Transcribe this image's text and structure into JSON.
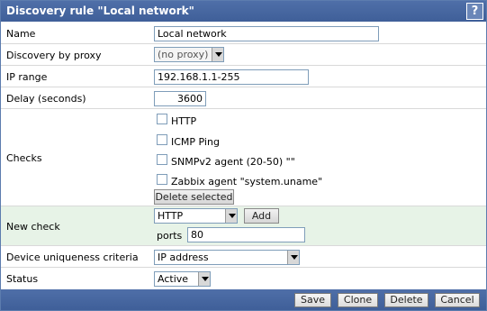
{
  "title": "Discovery rule \"Local network\"",
  "help_label": "?",
  "fields": {
    "name": {
      "label": "Name",
      "value": "Local network"
    },
    "proxy": {
      "label": "Discovery by proxy",
      "value": "(no proxy)"
    },
    "ip_range": {
      "label": "IP range",
      "value": "192.168.1.1-255"
    },
    "delay": {
      "label": "Delay (seconds)",
      "value": "3600"
    },
    "checks": {
      "label": "Checks",
      "items": [
        {
          "label": "HTTP",
          "checked": false
        },
        {
          "label": "ICMP Ping",
          "checked": false
        },
        {
          "label": "SNMPv2 agent (20-50) \"\"",
          "checked": false
        },
        {
          "label": "Zabbix agent \"system.uname\"",
          "checked": false
        }
      ],
      "delete_label": "Delete selected"
    },
    "new_check": {
      "label": "New check",
      "type_value": "HTTP",
      "add_label": "Add",
      "ports_label": "ports",
      "ports_value": "80"
    },
    "uniqueness": {
      "label": "Device uniqueness criteria",
      "value": "IP address"
    },
    "status": {
      "label": "Status",
      "value": "Active"
    }
  },
  "footer": {
    "save": "Save",
    "clone": "Clone",
    "delete": "Delete",
    "cancel": "Cancel"
  },
  "colors": {
    "header_blue": "#4a6aa3",
    "highlight_green": "#e7f3e7"
  }
}
